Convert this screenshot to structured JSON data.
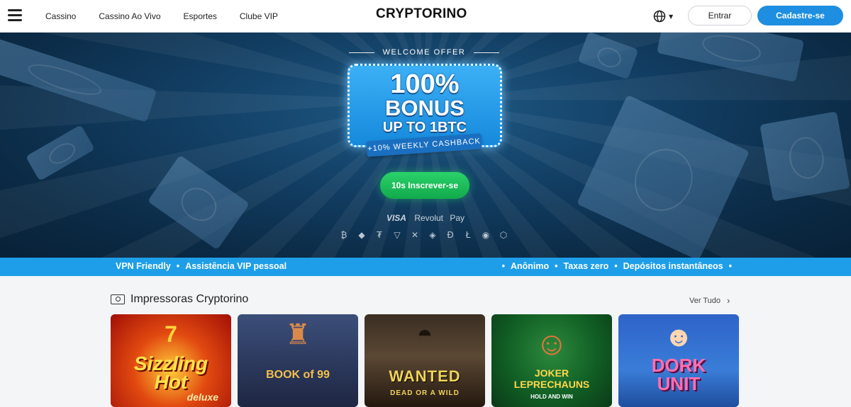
{
  "nav": {
    "items": [
      "Cassino",
      "Cassino Ao Vivo",
      "Esportes",
      "Clube VIP"
    ]
  },
  "logo": "CRYPTORINO",
  "header": {
    "login_label": "Entrar",
    "signup_label": "Cadastre-se"
  },
  "hero": {
    "welcome_offer": "WELCOME OFFER",
    "bonus_line1": "100%",
    "bonus_line2": "BONUS",
    "bonus_line3": "UP TO 1BTC",
    "cashback": "+10% WEEKLY CASHBACK",
    "cta_label": "10s Inscrever-se",
    "payments": {
      "visa": "VISA",
      "revolut": "Revolut",
      "apple_pay": "Pay"
    },
    "coins": [
      "bitcoin",
      "ethereum",
      "tether",
      "tron",
      "xrp",
      "bnb",
      "dogecoin",
      "litecoin",
      "shiba",
      "chainlink"
    ]
  },
  "strip": {
    "left": [
      "VPN Friendly",
      "Assistência VIP pessoal"
    ],
    "right": [
      "Anônimo",
      "Taxas zero",
      "Depósitos instantâneos"
    ]
  },
  "section": {
    "title": "Impressoras Cryptorino",
    "see_all": "Ver Tudo"
  },
  "games": [
    {
      "title_a": "Sizzling",
      "title_b": "Hot",
      "title_c": "deluxe"
    },
    {
      "title": "BOOK of 99"
    },
    {
      "title_a": "WANTED",
      "title_b": "DEAD OR A WILD"
    },
    {
      "title_a": "JOKER",
      "title_b": "LEPRECHAUNS",
      "title_c": "HOLD AND WIN"
    },
    {
      "title_a": "DORK",
      "title_b": "UNIT"
    }
  ]
}
